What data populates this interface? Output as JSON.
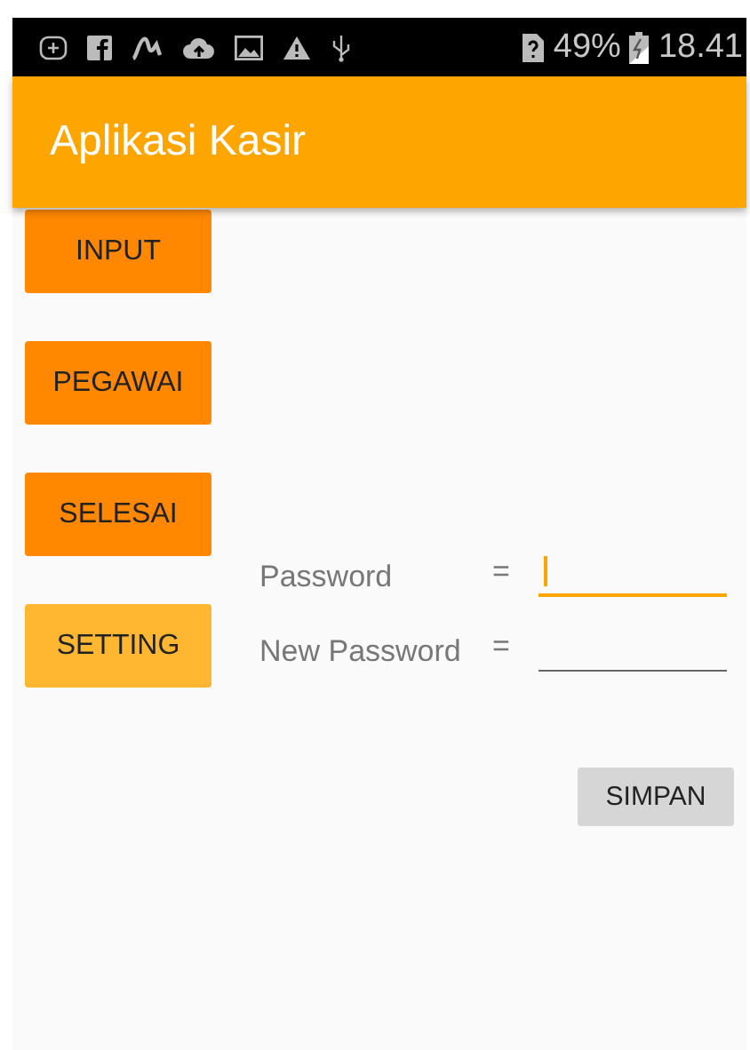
{
  "status_bar": {
    "battery": "49%",
    "time": "18.41"
  },
  "app_bar": {
    "title": "Aplikasi Kasir"
  },
  "menu": [
    {
      "label": "INPUT",
      "selected": false
    },
    {
      "label": "PEGAWAI",
      "selected": false
    },
    {
      "label": "SELESAI",
      "selected": false
    },
    {
      "label": "SETTING",
      "selected": true
    }
  ],
  "form": {
    "fields": [
      {
        "label": "Password",
        "separator": "=",
        "focused": true
      },
      {
        "label": "New Password",
        "separator": "=",
        "focused": false
      }
    ],
    "save_button": "SIMPAN"
  }
}
